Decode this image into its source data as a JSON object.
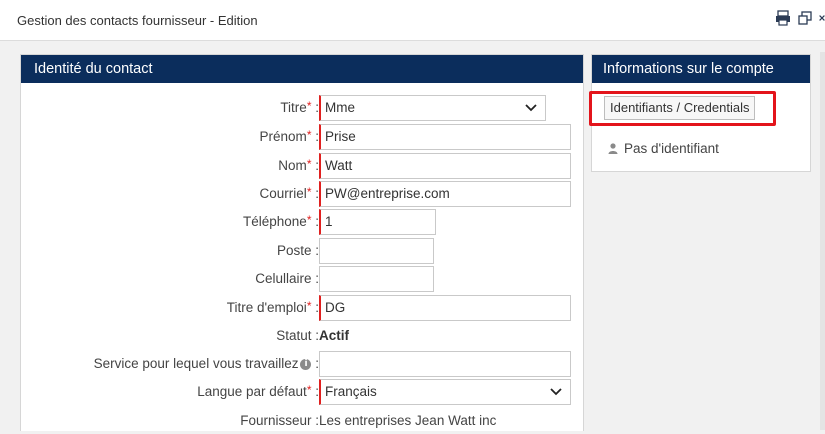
{
  "window": {
    "title": "Gestion des contacts fournisseur - Edition",
    "icons": [
      "print-icon",
      "popout-icon",
      "close-icon"
    ]
  },
  "identity_panel": {
    "header": "Identité du contact",
    "fields": {
      "titre": {
        "label": "Titre",
        "value": "Mme",
        "required": true
      },
      "prenom": {
        "label": "Prénom",
        "value": "Prise",
        "required": true
      },
      "nom": {
        "label": "Nom",
        "value": "Watt",
        "required": true
      },
      "courriel": {
        "label": "Courriel",
        "value": "PW@entreprise.com",
        "required": true
      },
      "telephone": {
        "label": "Téléphone",
        "value": "1",
        "required": true
      },
      "poste": {
        "label": "Poste",
        "value": "",
        "required": false
      },
      "cellulaire": {
        "label": "Celullaire",
        "value": "",
        "required": false
      },
      "titre_emploi": {
        "label": "Titre d'emploi",
        "value": "DG",
        "required": true
      },
      "statut": {
        "label": "Statut",
        "value": "Actif"
      },
      "service": {
        "label": "Service pour lequel vous travaillez",
        "value": "",
        "required": false
      },
      "langue": {
        "label": "Langue par défaut",
        "value": "Français",
        "required": true
      },
      "fournisseur": {
        "label": "Fournisseur",
        "value": "Les entreprises Jean Watt inc"
      }
    }
  },
  "account_panel": {
    "header": "Informations sur le compte",
    "credentials_button": "Identifiants / Credentials",
    "no_identifier": "Pas d'identifiant"
  },
  "colors": {
    "header_bg": "#0b2d5c",
    "required_marker": "#e0201f",
    "highlight": "#e3141b"
  }
}
